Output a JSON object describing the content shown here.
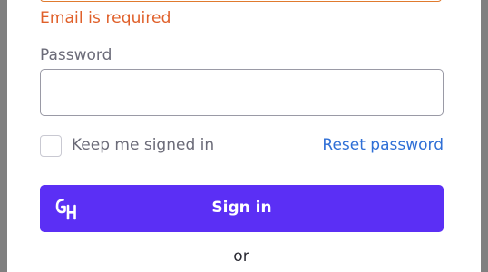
{
  "email": {
    "error": "Email is required"
  },
  "password": {
    "label": "Password",
    "value": "",
    "placeholder": ""
  },
  "options": {
    "keep_signed_in_label": "Keep me signed in",
    "keep_signed_in_checked": false,
    "reset_password_label": "Reset password"
  },
  "sign_in": {
    "label": "Sign in",
    "logo_icon": "grubhub-logo-icon",
    "color": "#5b2ff5"
  },
  "divider": {
    "or_label": "or"
  },
  "colors": {
    "error": "#e0602a",
    "link": "#2f6fd6",
    "label": "#6b6b78"
  }
}
